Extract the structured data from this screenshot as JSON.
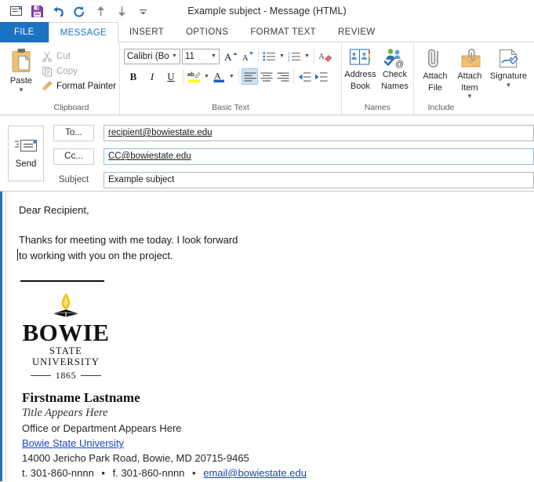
{
  "window": {
    "title": "Example subject - Message (HTML)"
  },
  "quick_access": [
    {
      "name": "message-icon",
      "glyph": "envelope"
    },
    {
      "name": "save-icon",
      "glyph": "floppy"
    },
    {
      "name": "undo-icon",
      "glyph": "undo"
    },
    {
      "name": "redo-icon",
      "glyph": "redo"
    },
    {
      "name": "previous-item-icon",
      "glyph": "arrow-up"
    },
    {
      "name": "next-item-icon",
      "glyph": "arrow-down"
    },
    {
      "name": "customize-qat-icon",
      "glyph": "caret-bar"
    }
  ],
  "tabs": [
    {
      "label": "FILE",
      "active": false,
      "is_file": true
    },
    {
      "label": "MESSAGE",
      "active": true,
      "is_file": false
    },
    {
      "label": "INSERT",
      "active": false,
      "is_file": false
    },
    {
      "label": "OPTIONS",
      "active": false,
      "is_file": false
    },
    {
      "label": "FORMAT TEXT",
      "active": false,
      "is_file": false
    },
    {
      "label": "REVIEW",
      "active": false,
      "is_file": false
    }
  ],
  "ribbon": {
    "clipboard": {
      "group_label": "Clipboard",
      "paste_label": "Paste",
      "cut_label": "Cut",
      "copy_label": "Copy",
      "format_painter_label": "Format Painter"
    },
    "basic_text": {
      "group_label": "Basic Text",
      "font_name": "Calibri (Boc",
      "font_size": "11",
      "grow_font_label": "A",
      "shrink_font_label": "A",
      "bold_label": "B",
      "italic_label": "I",
      "underline_label": "U",
      "font_color_label": "A"
    },
    "names": {
      "group_label": "Names",
      "address_book_line1": "Address",
      "address_book_line2": "Book",
      "check_names_line1": "Check",
      "check_names_line2": "Names"
    },
    "include": {
      "group_label": "Include",
      "attach_file_line1": "Attach",
      "attach_file_line2": "File",
      "attach_item_line1": "Attach",
      "attach_item_line2": "Item",
      "signature_line1": "Signature"
    }
  },
  "compose": {
    "send_label": "Send",
    "to_label": "To...",
    "cc_label": "Cc...",
    "subject_label": "Subject",
    "to_value": "recipient@bowiestate.edu",
    "cc_value": "CC@bowiestate.edu",
    "subject_value": "Example subject"
  },
  "body": {
    "greeting": "Dear Recipient,",
    "paragraph_line1": "Thanks for meeting with me today. I look forward",
    "paragraph_line2": "to working with you on the project."
  },
  "logo": {
    "wordmark": "BOWIE",
    "subtitle": "STATE UNIVERSITY",
    "year": "1865",
    "flame_color": "#f2c30d"
  },
  "signature": {
    "name": "Firstname Lastname",
    "title": "Title Appears Here",
    "department": "Office or Department Appears Here",
    "university_link": "Bowie State University",
    "address": "14000 Jericho Park Road, Bowie, MD 20715-9465",
    "phone": "t. 301-860-nnnn",
    "fax": "f. 301-860-nnnn",
    "email": "email@bowiestate.edu",
    "separator": "•"
  },
  "colors": {
    "file_tab": "#1b72c0",
    "active_tab_text": "#1b72c0",
    "link": "#1a43c8",
    "body_accent": "#1b72c0",
    "highlight_yellow": "#ffff00",
    "font_color_blue": "#1b5fb5"
  }
}
